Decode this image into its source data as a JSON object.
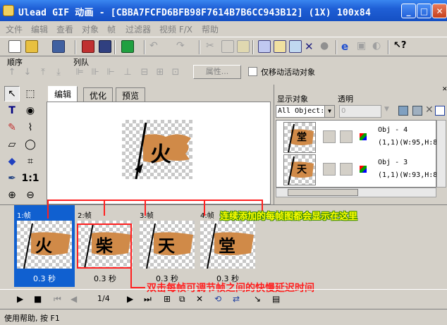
{
  "window": {
    "title": "Ulead GIF 动画 - [CBBA7FCFD6BFB98F7614B7B6CC943B12] (1X) 100x84",
    "buttons": {
      "minimize": "_",
      "maximize": "□",
      "close": "✕"
    }
  },
  "menu": [
    "文件",
    "编辑",
    "查看",
    "对象",
    "帧",
    "过滤器",
    "视频 F/X",
    "帮助"
  ],
  "order_bar": {
    "order_label": "顺序",
    "align_label": "列队",
    "properties_label": "属性...",
    "move_active_label": "仅移动活动对象"
  },
  "tabs": [
    "编辑",
    "优化",
    "预览"
  ],
  "canvas_char": "火",
  "object_panel": {
    "display_label": "显示对象",
    "opacity_label": "透明",
    "display_select": "All Object:",
    "opacity_value": "0",
    "objects": [
      {
        "char": "堂",
        "name": "Obj - 4",
        "info": "(1,1)(W:95,H:8"
      },
      {
        "char": "天",
        "name": "Obj - 3",
        "info": "(1,1)(W:93,H:8"
      }
    ]
  },
  "frames": [
    {
      "label": "1:帧",
      "char": "火",
      "delay": "0.3 秒"
    },
    {
      "label": "2:帧",
      "char": "柴",
      "delay": "0.3 秒"
    },
    {
      "label": "3:帧",
      "char": "天",
      "delay": "0.3 秒"
    },
    {
      "label": "4:帧",
      "char": "堂",
      "delay": "0.3 秒"
    }
  ],
  "playback": {
    "frame_counter": "1/4"
  },
  "annotations": {
    "frames_note": "连续添加的每帧图都会显示在这里",
    "delay_note": "双击每帧可调节帧之间的快慢延迟时间"
  },
  "status": "使用帮助, 按 F1",
  "colors": {
    "titlebar": "#1f5fd6",
    "selected_frame": "#1060d0",
    "annotation_red": "#ff2020",
    "annotation_yellow": "#ffff00",
    "flag_orange": "#d08a48"
  }
}
